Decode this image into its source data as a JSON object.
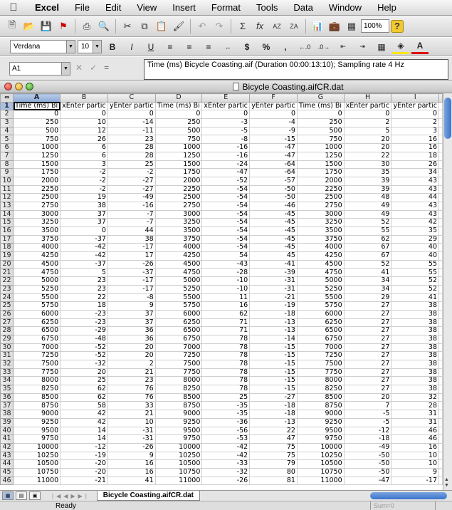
{
  "menubar": {
    "app": "Excel",
    "items": [
      "File",
      "Edit",
      "View",
      "Insert",
      "Format",
      "Tools",
      "Data",
      "Window",
      "Help"
    ]
  },
  "toolbar": {
    "zoom": "100%"
  },
  "formatbar": {
    "font": "Verdana",
    "size": "10"
  },
  "formula": {
    "cell_ref": "A1",
    "content": "Time (ms) Bicycle Coasting.aif (Duration 00:00:13:10); Sampling rate 4 Hz"
  },
  "window": {
    "title": "Bicycle Coasting.aifCR.dat"
  },
  "sheet": {
    "columns": [
      "A",
      "B",
      "C",
      "D",
      "E",
      "F",
      "G",
      "H",
      "I"
    ],
    "header_row": [
      "Time (ms) Bi",
      "xEnter partic",
      "yEnter partic",
      "Time (ms) Bi",
      "xEnter partic",
      "yEnter partic",
      "Time (ms) Bi",
      "xEnter partic",
      "yEnter partic"
    ],
    "rows": [
      [
        0,
        0,
        0,
        0,
        0,
        0,
        0,
        0,
        0
      ],
      [
        250,
        10,
        -14,
        250,
        -3,
        -4,
        250,
        2,
        2
      ],
      [
        500,
        12,
        -11,
        500,
        -5,
        -9,
        500,
        5,
        3
      ],
      [
        750,
        26,
        23,
        750,
        -8,
        -15,
        750,
        20,
        16
      ],
      [
        1000,
        6,
        28,
        1000,
        -16,
        -47,
        1000,
        20,
        16
      ],
      [
        1250,
        6,
        28,
        1250,
        -16,
        -47,
        1250,
        22,
        18
      ],
      [
        1500,
        3,
        25,
        1500,
        -24,
        -64,
        1500,
        30,
        26
      ],
      [
        1750,
        -2,
        -2,
        1750,
        -47,
        -64,
        1750,
        35,
        34
      ],
      [
        2000,
        -2,
        -27,
        2000,
        -52,
        -57,
        2000,
        39,
        43
      ],
      [
        2250,
        -2,
        -27,
        2250,
        -54,
        -50,
        2250,
        39,
        43
      ],
      [
        2500,
        19,
        -49,
        2500,
        -54,
        -50,
        2500,
        48,
        44
      ],
      [
        2750,
        38,
        -16,
        2750,
        -54,
        -46,
        2750,
        49,
        43
      ],
      [
        3000,
        37,
        -7,
        3000,
        -54,
        -45,
        3000,
        49,
        43
      ],
      [
        3250,
        37,
        -7,
        3250,
        -54,
        -45,
        3250,
        52,
        42
      ],
      [
        3500,
        0,
        44,
        3500,
        -54,
        -45,
        3500,
        55,
        35
      ],
      [
        3750,
        -37,
        38,
        3750,
        -54,
        -45,
        3750,
        62,
        29
      ],
      [
        4000,
        -42,
        -17,
        4000,
        -54,
        -45,
        4000,
        67,
        40
      ],
      [
        4250,
        -42,
        17,
        4250,
        54,
        45,
        4250,
        67,
        40
      ],
      [
        4500,
        -37,
        -26,
        4500,
        -43,
        -41,
        4500,
        52,
        55
      ],
      [
        4750,
        5,
        -37,
        4750,
        -28,
        -39,
        4750,
        41,
        55
      ],
      [
        5000,
        23,
        -17,
        5000,
        -10,
        -31,
        5000,
        34,
        52
      ],
      [
        5250,
        23,
        -17,
        5250,
        -10,
        -31,
        5250,
        34,
        52
      ],
      [
        5500,
        22,
        -8,
        5500,
        11,
        -21,
        5500,
        29,
        41
      ],
      [
        5750,
        18,
        9,
        5750,
        16,
        -19,
        5750,
        27,
        38
      ],
      [
        6000,
        -23,
        37,
        6000,
        62,
        -18,
        6000,
        27,
        38
      ],
      [
        6250,
        -23,
        37,
        6250,
        71,
        -13,
        6250,
        27,
        38
      ],
      [
        6500,
        -29,
        36,
        6500,
        71,
        -13,
        6500,
        27,
        38
      ],
      [
        6750,
        -48,
        36,
        6750,
        78,
        -14,
        6750,
        27,
        38
      ],
      [
        7000,
        -52,
        20,
        7000,
        78,
        -15,
        7000,
        27,
        38
      ],
      [
        7250,
        -52,
        20,
        7250,
        78,
        -15,
        7250,
        27,
        38
      ],
      [
        7500,
        -32,
        2,
        7500,
        78,
        -15,
        7500,
        27,
        38
      ],
      [
        7750,
        20,
        21,
        7750,
        78,
        -15,
        7750,
        27,
        38
      ],
      [
        8000,
        25,
        23,
        8000,
        78,
        -15,
        8000,
        27,
        38
      ],
      [
        8250,
        62,
        76,
        8250,
        78,
        -15,
        8250,
        27,
        38
      ],
      [
        8500,
        62,
        76,
        8500,
        25,
        -27,
        8500,
        20,
        32
      ],
      [
        8750,
        58,
        33,
        8750,
        -35,
        -18,
        8750,
        7,
        28
      ],
      [
        9000,
        42,
        21,
        9000,
        -35,
        -18,
        9000,
        -5,
        31
      ],
      [
        9250,
        42,
        10,
        9250,
        -36,
        -13,
        9250,
        -5,
        31
      ],
      [
        9500,
        14,
        -31,
        9500,
        -56,
        22,
        9500,
        -12,
        46
      ],
      [
        9750,
        14,
        -31,
        9750,
        -53,
        47,
        9750,
        -18,
        46
      ],
      [
        10000,
        -12,
        -26,
        10000,
        -42,
        75,
        10000,
        -49,
        16
      ],
      [
        10250,
        -19,
        9,
        10250,
        -42,
        75,
        10250,
        -50,
        10
      ],
      [
        10500,
        -20,
        16,
        10500,
        -33,
        79,
        10500,
        -50,
        10
      ],
      [
        10750,
        -20,
        16,
        10750,
        -32,
        80,
        10750,
        -50,
        9
      ],
      [
        11000,
        -21,
        41,
        11000,
        -26,
        81,
        11000,
        -47,
        -17
      ]
    ],
    "tab": "Bicycle Coasting.aifCR.dat"
  },
  "status": {
    "text": "Ready",
    "sum": "Sum=0"
  }
}
